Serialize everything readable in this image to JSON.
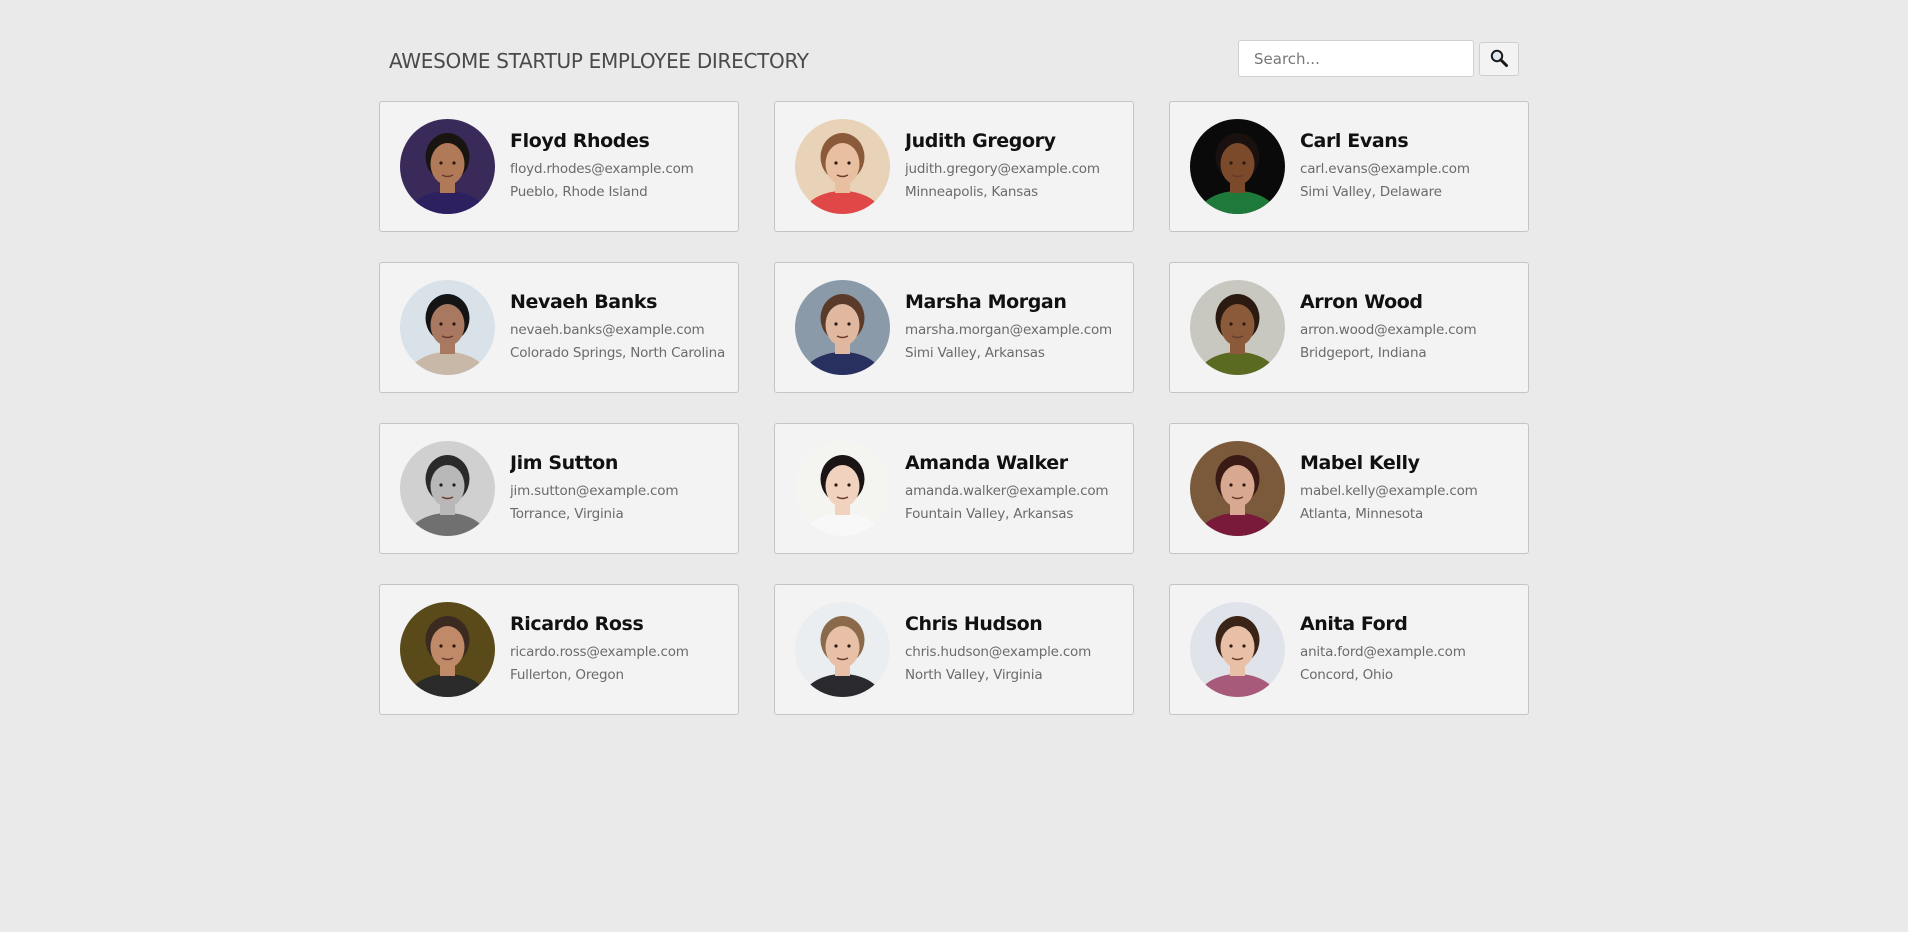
{
  "header": {
    "title": "AWESOME STARTUP EMPLOYEE DIRECTORY"
  },
  "search": {
    "placeholder": "Search...",
    "value": "",
    "button_icon": "magnifying-glass-icon"
  },
  "employees": [
    {
      "name": "Floyd Rhodes",
      "email": "floyd.rhodes@example.com",
      "location": "Pueblo, Rhode Island",
      "avatar": {
        "bg": "#3a2a5a",
        "skin": "#b07a58",
        "hair": "#1a1410",
        "shirt": "#2c2060"
      }
    },
    {
      "name": "Judith Gregory",
      "email": "judith.gregory@example.com",
      "location": "Minneapolis, Kansas",
      "avatar": {
        "bg": "#e8d2b8",
        "skin": "#e8bfa0",
        "hair": "#8a5a3a",
        "shirt": "#e04848"
      }
    },
    {
      "name": "Carl Evans",
      "email": "carl.evans@example.com",
      "location": "Simi Valley, Delaware",
      "avatar": {
        "bg": "#0a0a0a",
        "skin": "#7a4a2a",
        "hair": "#1a1010",
        "shirt": "#1e7a3a"
      }
    },
    {
      "name": "Nevaeh Banks",
      "email": "nevaeh.banks@example.com",
      "location": "Colorado Springs, North Carolina",
      "avatar": {
        "bg": "#d8e2e8",
        "skin": "#a87860",
        "hair": "#141414",
        "shirt": "#c8b8a8"
      }
    },
    {
      "name": "Marsha Morgan",
      "email": "marsha.morgan@example.com",
      "location": "Simi Valley, Arkansas",
      "avatar": {
        "bg": "#8a9aa8",
        "skin": "#e0b8a0",
        "hair": "#5a3a28",
        "shirt": "#283060"
      }
    },
    {
      "name": "Arron Wood",
      "email": "arron.wood@example.com",
      "location": "Bridgeport, Indiana",
      "avatar": {
        "bg": "#c8c8c0",
        "skin": "#8a5a3a",
        "hair": "#2a1a10",
        "shirt": "#5a6a20"
      }
    },
    {
      "name": "Jim Sutton",
      "email": "jim.sutton@example.com",
      "location": "Torrance, Virginia",
      "avatar": {
        "bg": "#d0d0d0",
        "skin": "#b8b8b8",
        "hair": "#2a2a2a",
        "shirt": "#707070"
      }
    },
    {
      "name": "Amanda Walker",
      "email": "amanda.walker@example.com",
      "location": "Fountain Valley, Arkansas",
      "avatar": {
        "bg": "#f4f4f0",
        "skin": "#f0d2be",
        "hair": "#1a1414",
        "shirt": "#f8f8f8"
      }
    },
    {
      "name": "Mabel Kelly",
      "email": "mabel.kelly@example.com",
      "location": "Atlanta, Minnesota",
      "avatar": {
        "bg": "#7a5a3a",
        "skin": "#d8a890",
        "hair": "#3a1a14",
        "shirt": "#7a1a3a"
      }
    },
    {
      "name": "Ricardo Ross",
      "email": "ricardo.ross@example.com",
      "location": "Fullerton, Oregon",
      "avatar": {
        "bg": "#5a4a1a",
        "skin": "#c08a68",
        "hair": "#3a2a20",
        "shirt": "#2a2a2a"
      }
    },
    {
      "name": "Chris Hudson",
      "email": "chris.hudson@example.com",
      "location": "North Valley, Virginia",
      "avatar": {
        "bg": "#eaeef0",
        "skin": "#e8c0a8",
        "hair": "#8a6a4a",
        "shirt": "#2a2a2e"
      }
    },
    {
      "name": "Anita Ford",
      "email": "anita.ford@example.com",
      "location": "Concord, Ohio",
      "avatar": {
        "bg": "#e0e4ea",
        "skin": "#e8c0a8",
        "hair": "#3a2418",
        "shirt": "#a85a7a"
      }
    }
  ]
}
